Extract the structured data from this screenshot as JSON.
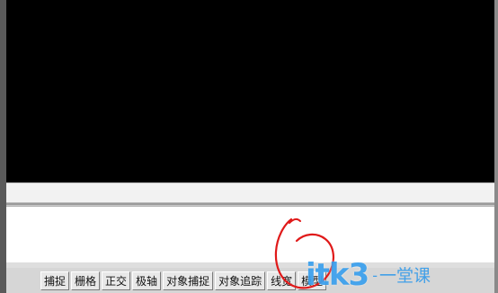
{
  "status_bar": {
    "buttons": [
      {
        "label": "捕捉",
        "pressed": false
      },
      {
        "label": "栅格",
        "pressed": false
      },
      {
        "label": "正交",
        "pressed": false
      },
      {
        "label": "极轴",
        "pressed": false
      },
      {
        "label": "对象捕捉",
        "pressed": false
      },
      {
        "label": "对象追踪",
        "pressed": false
      },
      {
        "label": "线宽",
        "pressed": false
      },
      {
        "label": "模型",
        "pressed": false
      }
    ]
  },
  "watermark": {
    "main": "itk3",
    "dash": "-",
    "sub": "一堂课"
  },
  "colors": {
    "drawing_background": "#000000",
    "annotation": "#e01a1a",
    "watermark": "#2896eb"
  }
}
